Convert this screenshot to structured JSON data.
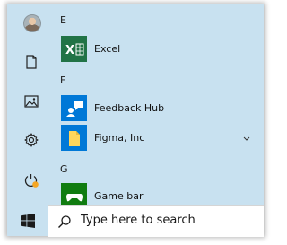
{
  "start_menu": {
    "sections": [
      {
        "letter": "E",
        "apps": [
          {
            "name": "Excel",
            "icon": "excel-icon",
            "color": "#217346"
          }
        ]
      },
      {
        "letter": "F",
        "apps": [
          {
            "name": "Feedback Hub",
            "icon": "feedback-hub-icon",
            "color": "#0078d7"
          },
          {
            "name": "Figma, Inc",
            "icon": "folder-icon",
            "color": "#0078d7",
            "expandable": true
          }
        ]
      },
      {
        "letter": "G",
        "apps": [
          {
            "name": "Game bar",
            "icon": "game-bar-icon",
            "color": "#107c10"
          }
        ]
      }
    ],
    "rail": [
      "avatar",
      "document-icon",
      "pictures-icon",
      "settings-gear-icon",
      "power-icon"
    ]
  },
  "taskbar": {
    "start_icon": "windows-logo-icon",
    "search_placeholder": "Type here to search",
    "search_icon": "search-icon"
  },
  "colors": {
    "menu_bg": "#c8e1f0",
    "accent": "#0078d7",
    "excel": "#217346",
    "game_bar": "#107c10"
  }
}
